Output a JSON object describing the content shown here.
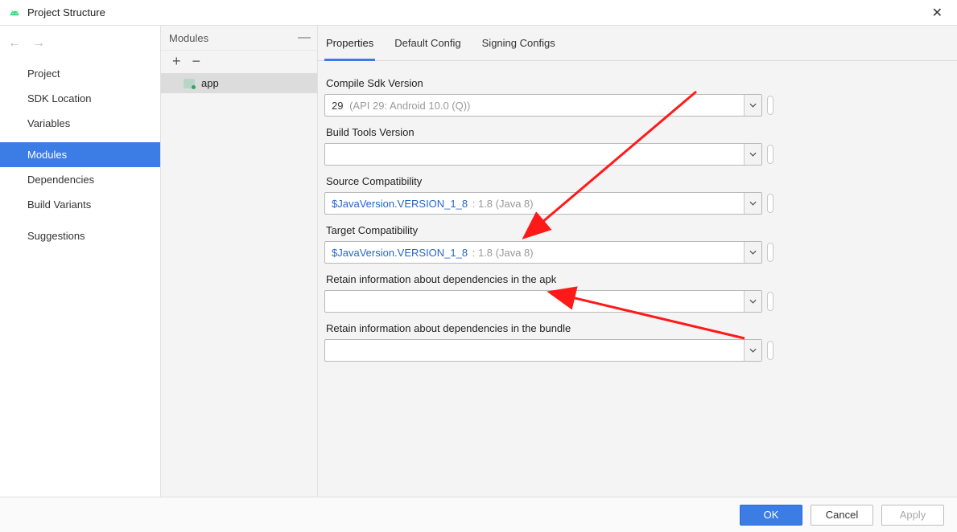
{
  "window": {
    "title": "Project Structure"
  },
  "sidebar": {
    "items": [
      {
        "label": "Project"
      },
      {
        "label": "SDK Location"
      },
      {
        "label": "Variables"
      },
      {
        "label": "Modules"
      },
      {
        "label": "Dependencies"
      },
      {
        "label": "Build Variants"
      },
      {
        "label": "Suggestions"
      }
    ],
    "selected_index": 3
  },
  "modules": {
    "header": "Modules",
    "items": [
      {
        "name": "app"
      }
    ]
  },
  "tabs": {
    "items": [
      {
        "label": "Properties"
      },
      {
        "label": "Default Config"
      },
      {
        "label": "Signing Configs"
      }
    ],
    "active_index": 0
  },
  "fields": {
    "compileSdk": {
      "label": "Compile Sdk Version",
      "value": "29",
      "hint": "(API 29: Android 10.0 (Q))"
    },
    "buildTools": {
      "label": "Build Tools Version",
      "value": ""
    },
    "sourceCompat": {
      "label": "Source Compatibility",
      "value": "$JavaVersion.VERSION_1_8",
      "hint": ": 1.8 (Java 8)"
    },
    "targetCompat": {
      "label": "Target Compatibility",
      "value": "$JavaVersion.VERSION_1_8",
      "hint": ": 1.8 (Java 8)"
    },
    "retainApk": {
      "label": "Retain information about dependencies in the apk",
      "value": ""
    },
    "retainBundle": {
      "label": "Retain information about dependencies in the bundle",
      "value": ""
    }
  },
  "buttons": {
    "ok": "OK",
    "cancel": "Cancel",
    "apply": "Apply"
  },
  "colors": {
    "accent": "#3b7de5"
  }
}
